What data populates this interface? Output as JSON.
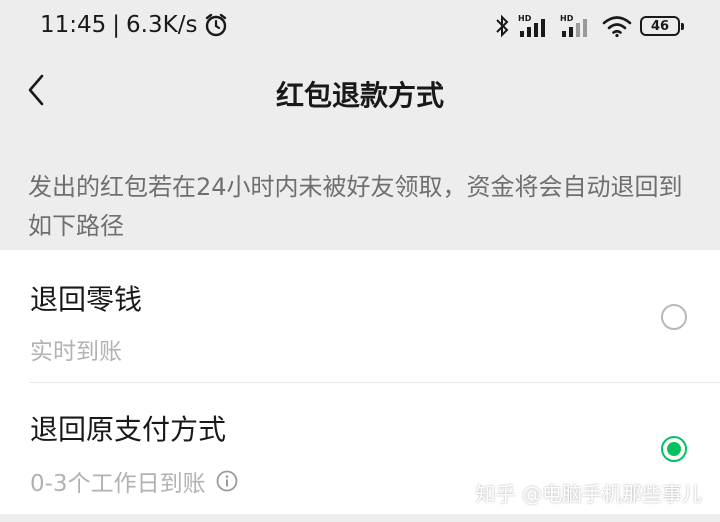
{
  "status_bar": {
    "time": "11:45",
    "separator": "|",
    "speed": "6.3K/s",
    "battery": "46",
    "signal_label_1": "HD",
    "signal_label_2": "HD"
  },
  "nav": {
    "title": "红包退款方式"
  },
  "notice": "发出的红包若在24小时内未被好友领取，资金将会自动退回到如下路径",
  "options": [
    {
      "title": "退回零钱",
      "subtitle": "实时到账",
      "selected": false
    },
    {
      "title": "退回原支付方式",
      "subtitle": "0-3个工作日到账",
      "selected": true
    }
  ],
  "watermark": "知乎 @电脑手机那些事儿",
  "colors": {
    "background": "#ededed",
    "card": "#ffffff",
    "accent": "#07c160",
    "secondary_text": "#b2b2b2"
  }
}
